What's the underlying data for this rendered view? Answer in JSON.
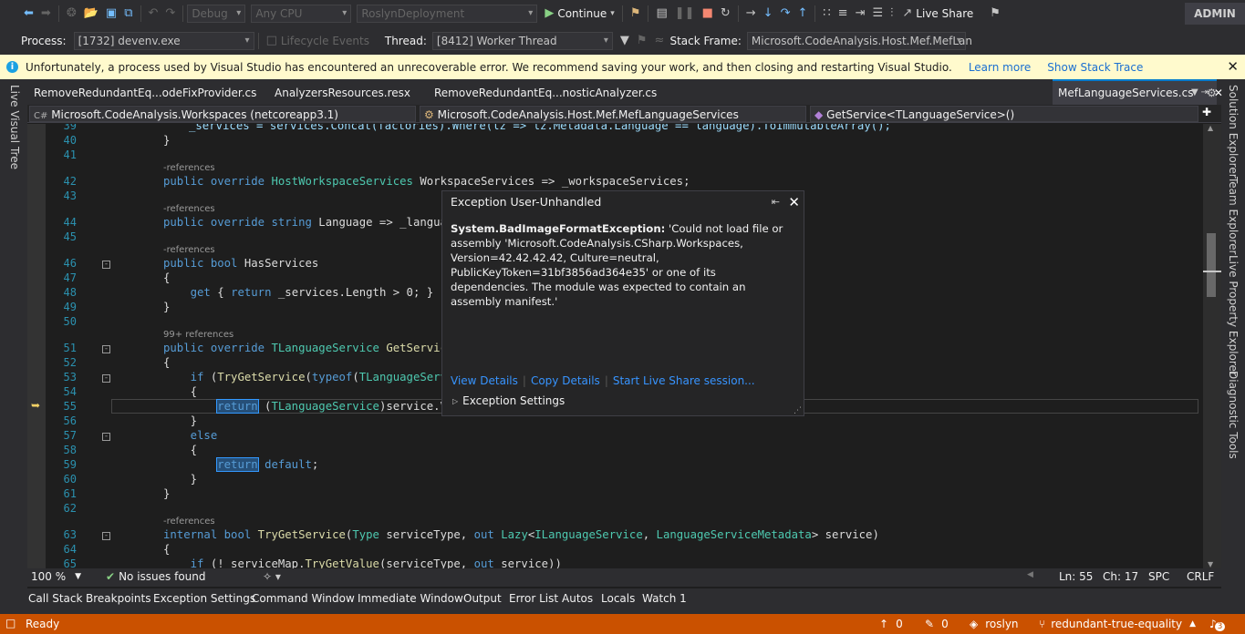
{
  "toolbar": {
    "config": "Debug",
    "platform": "Any CPU",
    "startup_project": "RoslynDeployment",
    "continue_label": "Continue",
    "live_share": "Live Share",
    "admin": "ADMIN"
  },
  "debug_bar": {
    "process_label": "Process:",
    "process_value": "[1732] devenv.exe",
    "lifecycle": "Lifecycle Events",
    "thread_label": "Thread:",
    "thread_value": "[8412] Worker Thread",
    "stack_label": "Stack Frame:",
    "stack_value": "Microsoft.CodeAnalysis.Host.Mef.MefLan"
  },
  "infobar": {
    "message": "Unfortunately, a process used by Visual Studio has encountered an unrecoverable error.  We recommend saving your work, and then closing and restarting Visual Studio.",
    "learn_more": "Learn more",
    "show_stack": "Show Stack Trace"
  },
  "left_panel": {
    "live_visual_tree": "Live Visual Tree"
  },
  "right_panel": {
    "solution_explorer": "Solution Explorer",
    "team_explorer": "Team Explorer",
    "live_property_explorer": "Live Property Explorer",
    "diagnostic_tools": "Diagnostic Tools"
  },
  "tabs": [
    "RemoveRedundantEq...odeFixProvider.cs",
    "AnalyzersResources.resx",
    "RemoveRedundantEq...nosticAnalyzer.cs"
  ],
  "active_tab": "MefLanguageServices.cs",
  "navbar": {
    "project": "Microsoft.CodeAnalysis.Workspaces (netcoreapp3.1)",
    "type": "Microsoft.CodeAnalysis.Host.Mef.MefLanguageServices",
    "member": "GetService<TLanguageService>()"
  },
  "code": {
    "l39": "_services = services.Concat(factories).Where(lz => lz.Metadata.Language == language).ToImmutableArray();",
    "refs0": "references",
    "refs99": "99+ references"
  },
  "exception": {
    "title": "Exception User-Unhandled",
    "type": "System.BadImageFormatException:",
    "message": " 'Could not load file or assembly 'Microsoft.CodeAnalysis.CSharp.Workspaces, Version=42.42.42.42, Culture=neutral, PublicKeyToken=31bf3856ad364e35' or one of its dependencies. The module was expected to contain an assembly manifest.'",
    "view_details": "View Details",
    "copy_details": "Copy Details",
    "live_share": "Start Live Share session...",
    "settings": "Exception Settings"
  },
  "editor_status": {
    "zoom": "100 %",
    "issues": "No issues found",
    "ln": "Ln: 55",
    "ch": "Ch: 17",
    "spc": "SPC",
    "crlf": "CRLF"
  },
  "panel_tabs": [
    "Call Stack",
    "Breakpoints",
    "Exception Settings",
    "Command Window",
    "Immediate Window",
    "Output",
    "Error List",
    "Autos",
    "Locals",
    "Watch 1"
  ],
  "statusbar": {
    "ready": "Ready",
    "up": "0",
    "edits": "0",
    "repo": "roslyn",
    "branch": "redundant-true-equality",
    "notifications": "3"
  }
}
